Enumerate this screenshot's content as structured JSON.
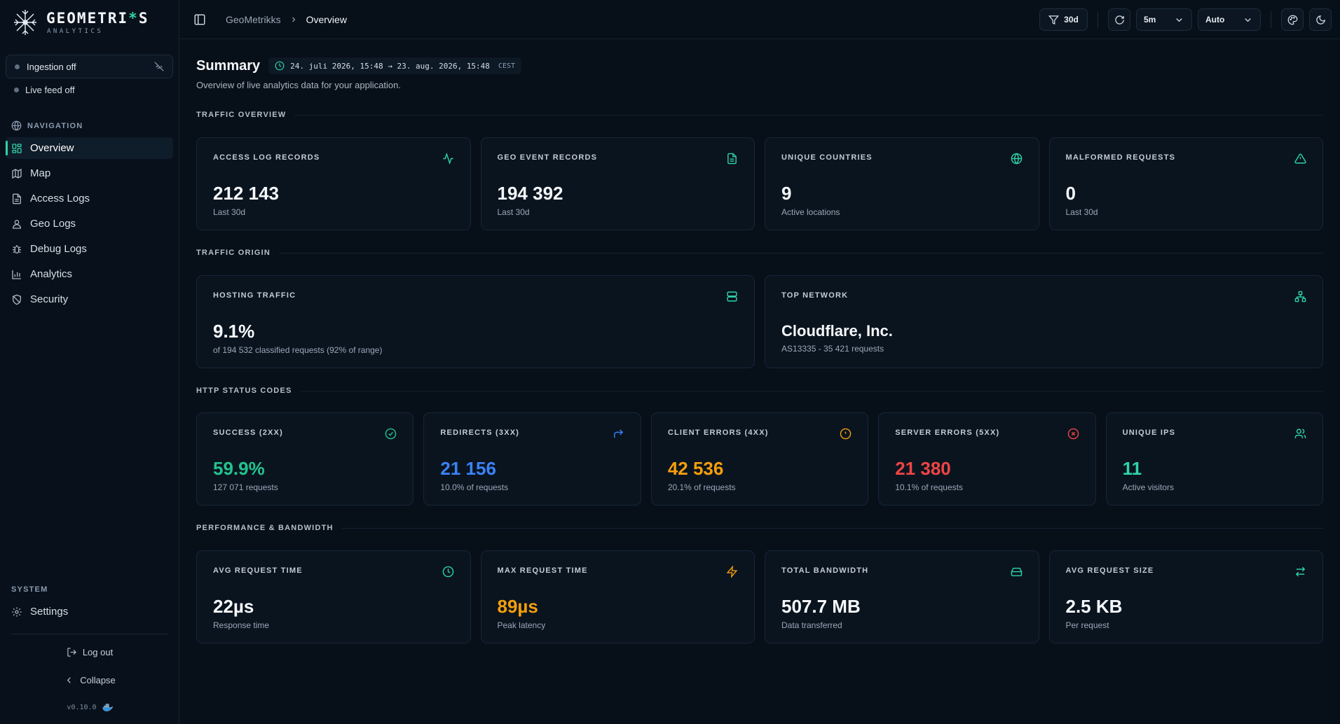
{
  "brand": {
    "title_a": "GEOMETRI",
    "title_accent": "*",
    "title_b": "S",
    "subtitle": "ANALYTICS"
  },
  "status": {
    "ingestion": "Ingestion off",
    "live_feed": "Live feed off"
  },
  "sidebar": {
    "nav_label": "NAVIGATION",
    "items": [
      {
        "label": "Overview",
        "icon": "dashboard-icon"
      },
      {
        "label": "Map",
        "icon": "map-icon"
      },
      {
        "label": "Access Logs",
        "icon": "file-icon"
      },
      {
        "label": "Geo Logs",
        "icon": "user-pin-icon"
      },
      {
        "label": "Debug Logs",
        "icon": "bug-icon"
      },
      {
        "label": "Analytics",
        "icon": "bar-chart-icon"
      },
      {
        "label": "Security",
        "icon": "shield-icon"
      }
    ],
    "system_label": "SYSTEM",
    "settings": "Settings",
    "logout": "Log out",
    "collapse": "Collapse",
    "version": "v0.10.0"
  },
  "topbar": {
    "breadcrumb_root": "GeoMetrikks",
    "breadcrumb_current": "Overview",
    "filter": "30d",
    "refresh_interval": "5m",
    "mode": "Auto"
  },
  "summary": {
    "title": "Summary",
    "range": "24. juli 2026, 15:48 → 23. aug. 2026, 15:48",
    "timezone": "CEST",
    "description": "Overview of live analytics data for your application."
  },
  "groups": {
    "traffic_overview": "TRAFFIC OVERVIEW",
    "traffic_origin": "TRAFFIC ORIGIN",
    "http_status": "HTTP STATUS CODES",
    "performance": "PERFORMANCE & BANDWIDTH"
  },
  "traffic_overview": [
    {
      "title": "ACCESS LOG RECORDS",
      "value": "212 143",
      "sub": "Last 30d",
      "icon": "activity-icon"
    },
    {
      "title": "GEO EVENT RECORDS",
      "value": "194 392",
      "sub": "Last 30d",
      "icon": "document-icon"
    },
    {
      "title": "UNIQUE COUNTRIES",
      "value": "9",
      "sub": "Active locations",
      "icon": "globe-icon"
    },
    {
      "title": "MALFORMED REQUESTS",
      "value": "0",
      "sub": "Last 30d",
      "icon": "warning-icon"
    }
  ],
  "traffic_origin": [
    {
      "title": "HOSTING TRAFFIC",
      "value": "9.1%",
      "sub": "of 194 532 classified requests (92% of range)",
      "icon": "server-icon"
    },
    {
      "title": "TOP NETWORK",
      "value": "Cloudflare, Inc.",
      "sub": "AS13335 - 35 421 requests",
      "icon": "network-icon"
    }
  ],
  "http_status": [
    {
      "title": "SUCCESS (2XX)",
      "value": "59.9%",
      "sub": "127 071 requests",
      "icon": "check-circle-icon",
      "color": "#22c38e"
    },
    {
      "title": "REDIRECTS (3XX)",
      "value": "21 156",
      "sub": "10.0% of requests",
      "icon": "redirect-arrow-icon",
      "color": "#3b82f6"
    },
    {
      "title": "CLIENT ERRORS (4XX)",
      "value": "42 536",
      "sub": "20.1% of requests",
      "icon": "alert-circle-icon",
      "color": "#f59e0b"
    },
    {
      "title": "SERVER ERRORS (5XX)",
      "value": "21 380",
      "sub": "10.1% of requests",
      "icon": "x-circle-icon",
      "color": "#ef4444"
    },
    {
      "title": "UNIQUE IPS",
      "value": "11",
      "sub": "Active visitors",
      "icon": "users-icon",
      "color": "#2fd3a7"
    }
  ],
  "performance": [
    {
      "title": "AVG REQUEST TIME",
      "value": "22µs",
      "sub": "Response time",
      "icon": "clock-icon",
      "color": "#f6f9fb"
    },
    {
      "title": "MAX REQUEST TIME",
      "value": "89µs",
      "sub": "Peak latency",
      "icon": "zap-icon",
      "color": "#f59e0b"
    },
    {
      "title": "TOTAL BANDWIDTH",
      "value": "507.7 MB",
      "sub": "Data transferred",
      "icon": "hard-drive-icon",
      "color": "#f6f9fb"
    },
    {
      "title": "AVG REQUEST SIZE",
      "value": "2.5 KB",
      "sub": "Per request",
      "icon": "swap-icon",
      "color": "#f6f9fb"
    }
  ],
  "colors": {
    "accent": "#2fd3a7",
    "background": "#070f18",
    "card": "#0a141f"
  }
}
